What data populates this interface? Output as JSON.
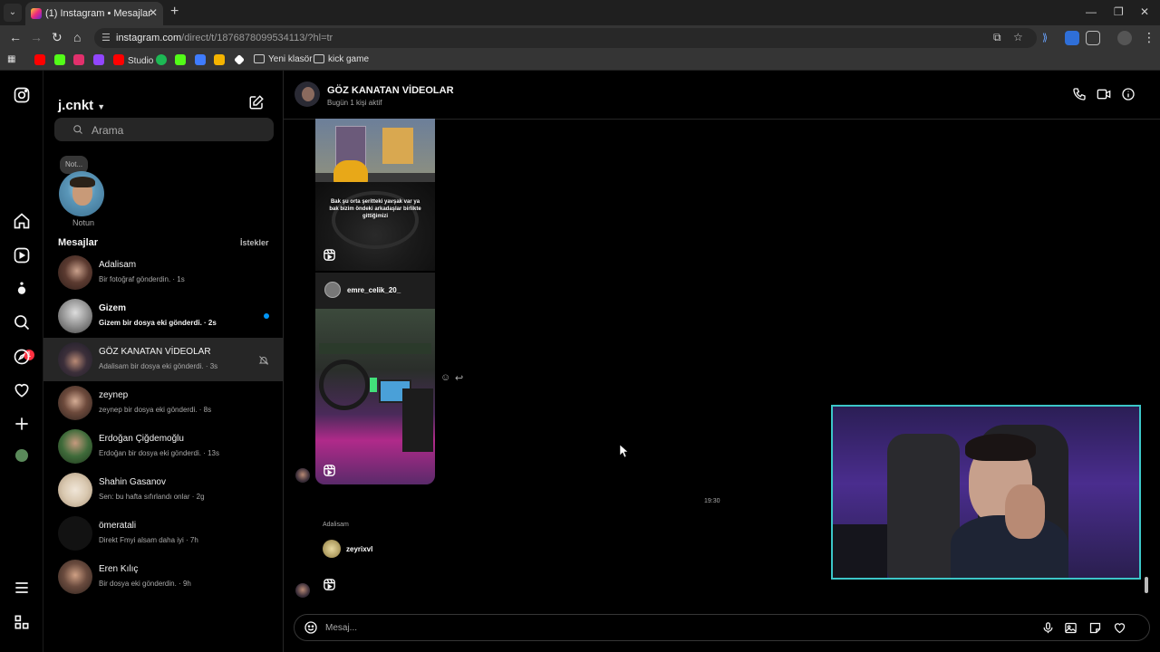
{
  "browser": {
    "tab_title": "(1) Instagram • Mesajlar",
    "url_host": "instagram.com",
    "url_path": "/direct/t/1876878099534113/?hl=tr",
    "bookmarks": [
      {
        "label": "",
        "color": "#ff0000"
      },
      {
        "label": "",
        "color": "#53fc18"
      },
      {
        "label": "",
        "color": "#e1306c"
      },
      {
        "label": "",
        "color": "#9146ff"
      },
      {
        "label": "Studio",
        "color": "#ff0000"
      },
      {
        "label": "",
        "color": "#1db954"
      },
      {
        "label": "",
        "color": "#53fc18"
      },
      {
        "label": "",
        "color": "#3f7cff"
      },
      {
        "label": "",
        "color": "#f5b400"
      },
      {
        "label": "",
        "color": "#ffffff"
      },
      {
        "label": "Yeni klasör",
        "color": "#cccccc"
      },
      {
        "label": "kick game",
        "color": "#cccccc"
      }
    ]
  },
  "inbox": {
    "account": "j.cnkt",
    "search_placeholder": "Arama",
    "note_bubble": "Not...",
    "note_label": "Notun",
    "messages_title": "Mesajlar",
    "requests_label": "İstekler",
    "notification_count": "1",
    "conversations": [
      {
        "name": "Adalisam",
        "preview": "Bir fotoğraf gönderdin. · 1s",
        "unread": false,
        "selected": false
      },
      {
        "name": "Gizem",
        "preview": "Gizem bir dosya eki gönderdi. · 2s",
        "unread": true,
        "selected": false
      },
      {
        "name": "GÖZ KANATAN VİDEOLAR",
        "preview": "Adalisam bir dosya eki gönderdi. · 3s",
        "unread": false,
        "selected": true,
        "muted": true
      },
      {
        "name": "zeynep",
        "preview": "zeynep bir dosya eki gönderdi. · 8s",
        "unread": false,
        "selected": false
      },
      {
        "name": "Erdoğan Çiğdemoğlu",
        "preview": "Erdoğan bir dosya eki gönderdi. · 13s",
        "unread": false,
        "selected": false
      },
      {
        "name": "Shahin Gasanov",
        "preview": "Sen: bu hafta sıfırlandı onlar · 2g",
        "unread": false,
        "selected": false
      },
      {
        "name": "ömeratali",
        "preview": "Direkt Fmyi alsam daha iyi · 7h",
        "unread": false,
        "selected": false
      },
      {
        "name": "Eren Kılıç",
        "preview": "Bir dosya eki gönderdin. · 9h",
        "unread": false,
        "selected": false
      }
    ]
  },
  "chat": {
    "title": "GÖZ KANATAN VİDEOLAR",
    "subtitle": "Bugün 1 kişi aktif",
    "reel1_caption": "Bak şu orta şeritteki yavşak var ya bak bizim öndeki arkadaşlar birlikte gittiğimizi",
    "reel2_user": "emre_celik_20_",
    "timestamp": "19:30",
    "sender_name": "Adalisam",
    "shared_user": "zeyrixvl",
    "message_placeholder": "Mesaj..."
  }
}
